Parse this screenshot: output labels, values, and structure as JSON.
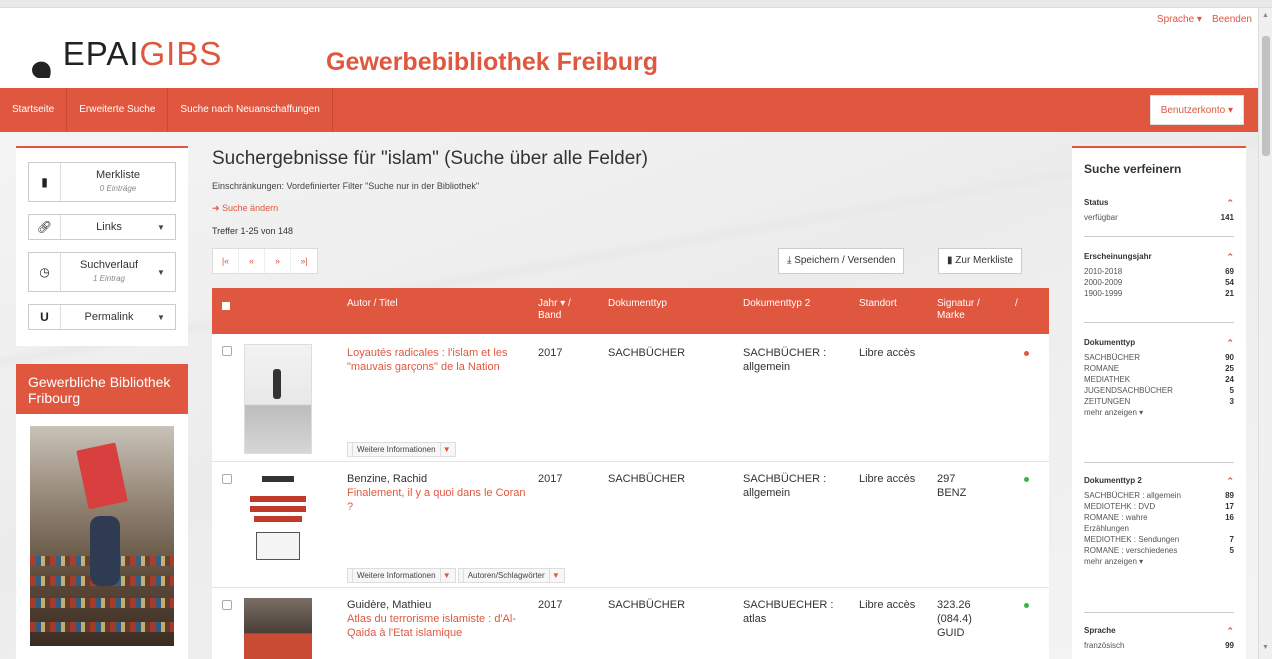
{
  "header": {
    "logo_mark": "❟",
    "logo_prefix": "EPAI",
    "logo_suffix": "GIBS",
    "library_title": "Gewerbebibliothek Freiburg",
    "language": "Sprache ▾",
    "logout": "Beenden"
  },
  "nav": {
    "items": [
      "Startseite",
      "Erweiterte Suche",
      "Suche nach Neuanschaffungen"
    ],
    "account": "Benutzerkonto ▾"
  },
  "left": {
    "merkliste": {
      "label": "Merkliste",
      "sub": "0 Einträge"
    },
    "links": {
      "label": "Links"
    },
    "suchverlauf": {
      "label": "Suchverlauf",
      "sub": "1 Eintrag"
    },
    "permalink": {
      "label": "Permalink"
    },
    "library_box_title": "Gewerbliche Bibliothek Fribourg"
  },
  "main": {
    "title": "Suchergebnisse für \"islam\" (Suche über alle Felder)",
    "restriction": "Einschränkungen: Vordefinierter Filter \"Suche nur in der Bibliothek\"",
    "change_search": "➜ Suche ändern",
    "hits": "Treffer 1-25 von 148",
    "pager": [
      "|«",
      "«",
      "»",
      "»|"
    ],
    "save_send": "⤓ Speichern / Versenden",
    "to_merkliste": "Zur Merkliste",
    "columns": [
      "Autor / Titel",
      "Jahr ▾ / Band",
      "Dokumenttyp",
      "Dokumenttyp 2",
      "Standort",
      "Signatur / Marke",
      "/"
    ],
    "rows": [
      {
        "author": "",
        "title": "Loyautés radicales : l'islam et les \"mauvais garçons\" de la Nation",
        "year": "2017",
        "doctype": "SACHBÜCHER",
        "doctype2": "SACHBÜCHER : allgemein",
        "location": "Libre accès",
        "signature": "",
        "status_color": "#e0573f",
        "buttons": [
          "Weitere Informationen"
        ]
      },
      {
        "author": "Benzine, Rachid",
        "title": "Finalement, il y a quoi dans le Coran ?",
        "year": "2017",
        "doctype": "SACHBÜCHER",
        "doctype2": "SACHBÜCHER : allgemein",
        "location": "Libre accès",
        "signature": "297 BENZ",
        "status_color": "#3cb34a",
        "buttons": [
          "Weitere Informationen",
          "Autoren/Schlagwörter"
        ]
      },
      {
        "author": "Guidère, Mathieu",
        "title": "Atlas du terrorisme islamiste : d'Al-Qaida à l'Etat islamique",
        "year": "2017",
        "doctype": "SACHBÜCHER",
        "doctype2": "SACHBUECHER : atlas",
        "location": "Libre accès",
        "signature": "323.26 (084.4) GUID",
        "status_color": "#3cb34a",
        "buttons": []
      }
    ]
  },
  "facets": {
    "title": "Suche verfeinern",
    "groups": [
      {
        "name": "Status",
        "items": [
          {
            "label": "verfügbar",
            "count": "141"
          }
        ]
      },
      {
        "name": "Erscheinungsjahr",
        "items": [
          {
            "label": "2010-2018",
            "count": "69"
          },
          {
            "label": "2000-2009",
            "count": "54"
          },
          {
            "label": "1900-1999",
            "count": "21"
          }
        ]
      },
      {
        "name": "Dokumenttyp",
        "items": [
          {
            "label": "SACHBÜCHER",
            "count": "90"
          },
          {
            "label": "ROMANE",
            "count": "25"
          },
          {
            "label": "MEDIATHEK",
            "count": "24"
          },
          {
            "label": "JUGENDSACHBÜCHER",
            "count": "5"
          },
          {
            "label": "ZEITUNGEN",
            "count": "3"
          }
        ],
        "more": "mehr anzeigen ▾"
      },
      {
        "name": "Dokumenttyp 2",
        "items": [
          {
            "label": "SACHBÜCHER : allgemein",
            "count": "89"
          },
          {
            "label": "MEDIOTEHK : DVD",
            "count": "17"
          },
          {
            "label": "ROMANE : wahre Erzählungen",
            "count": "16"
          },
          {
            "label": "MEDIOTHEK : Sendungen",
            "count": "7"
          },
          {
            "label": "ROMANE : verschiedenes",
            "count": "5"
          }
        ],
        "more": "mehr anzeigen ▾"
      },
      {
        "name": "Sprache",
        "items": [
          {
            "label": "französisch",
            "count": "99"
          }
        ]
      }
    ]
  },
  "colors": {
    "accent": "#e0573f",
    "available": "#3cb34a"
  }
}
